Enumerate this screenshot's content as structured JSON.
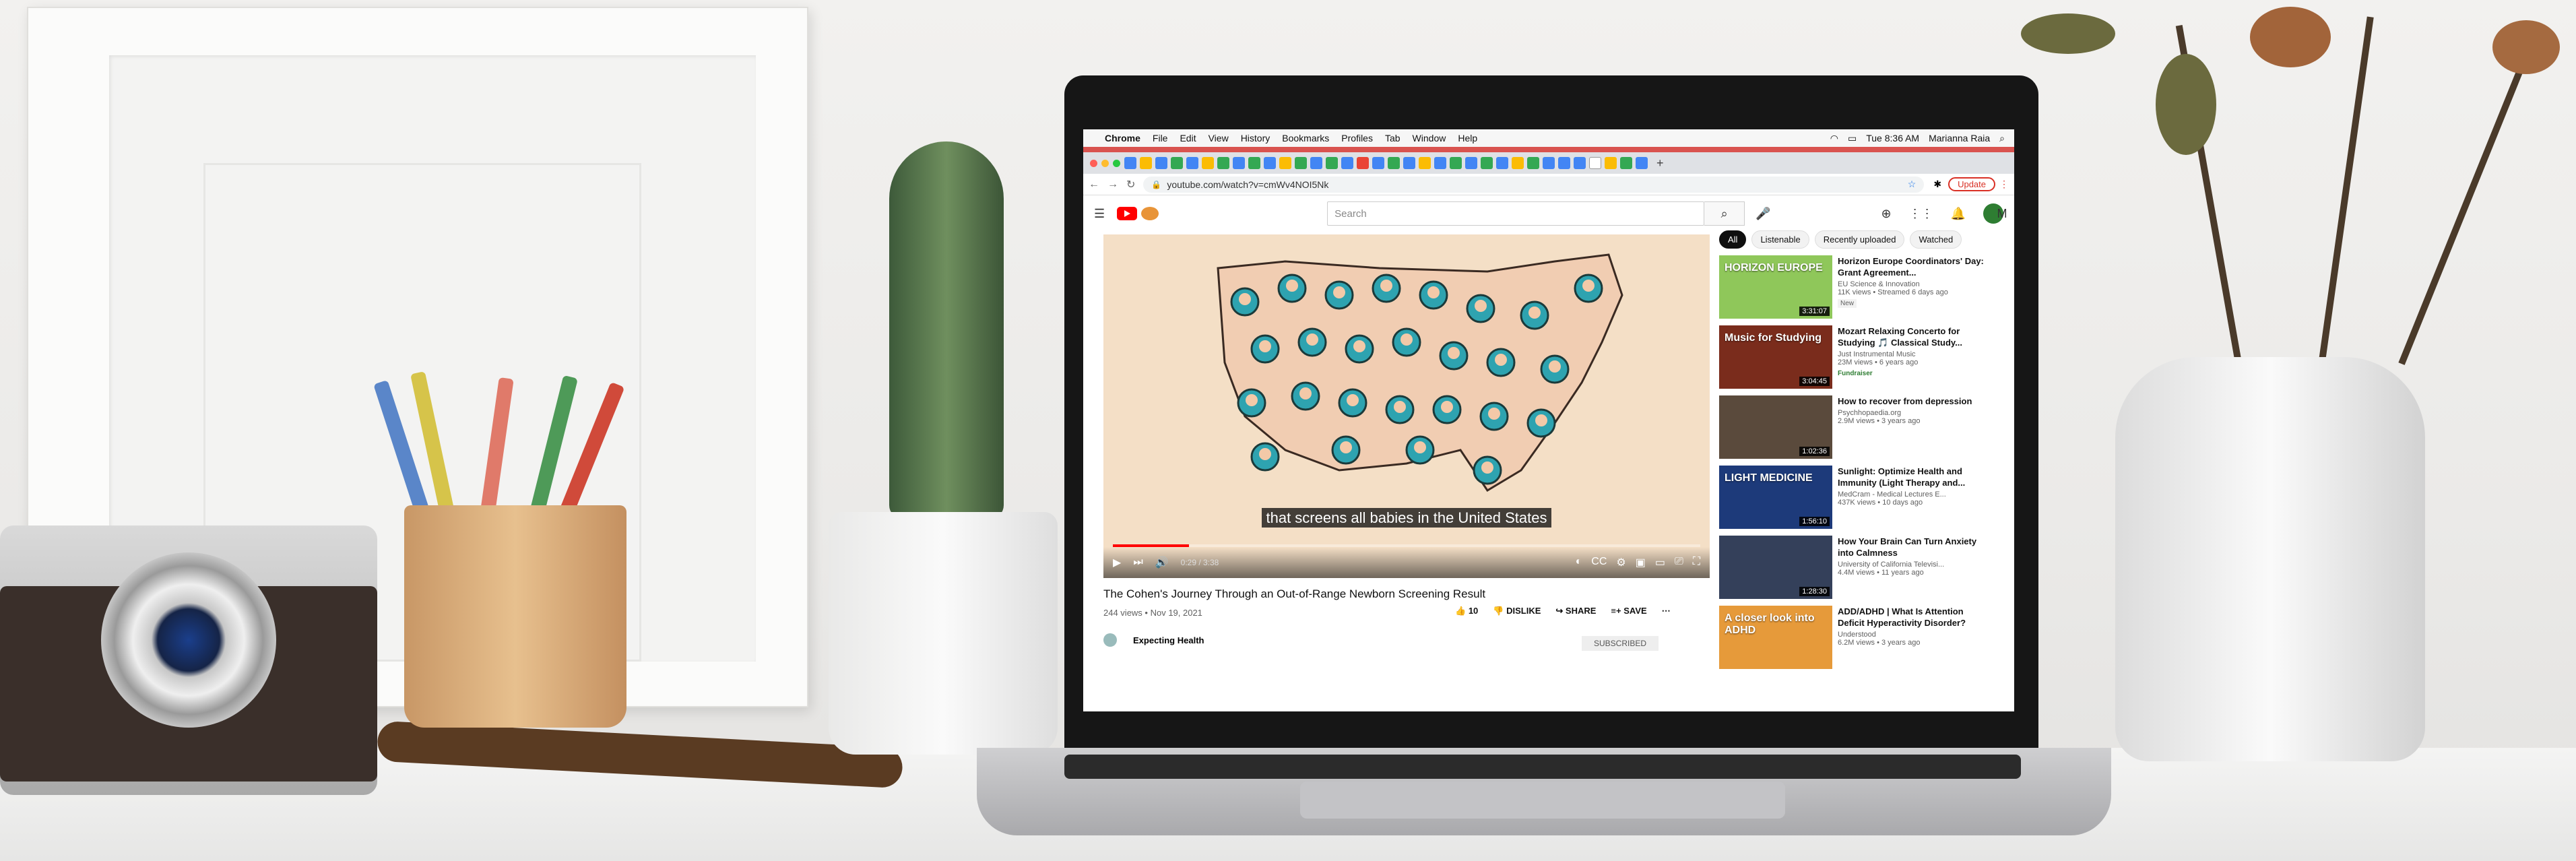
{
  "menubar": {
    "app": "Chrome",
    "items": [
      "File",
      "Edit",
      "View",
      "History",
      "Bookmarks",
      "Profiles",
      "Tab",
      "Window",
      "Help"
    ],
    "clock": "Tue 8:36 AM",
    "user": "Marianna Raia"
  },
  "browser": {
    "url": "youtube.com/watch?v=cmWv4NOI5Nk",
    "update_label": "Update"
  },
  "youtube": {
    "search_placeholder": "Search",
    "avatar_letter": "M",
    "video": {
      "caption": "that screens all babies in the United States",
      "time": "0:29 / 3:38",
      "progress": 0.13,
      "title": "The Cohen's Journey Through an Out-of-Range Newborn Screening Result",
      "meta": "244 views • Nov 19, 2021",
      "likes": "10",
      "dislike_label": "DISLIKE",
      "share_label": "SHARE",
      "save_label": "SAVE",
      "channel": "Expecting Health",
      "subscribed_label": "SUBSCRIBED"
    },
    "chips": [
      "All",
      "Listenable",
      "Recently uploaded",
      "Watched"
    ],
    "recommendations": [
      {
        "title": "Horizon Europe Coordinators' Day: Grant Agreement...",
        "channel": "EU Science & Innovation",
        "meta": "11K views • Streamed 6 days ago",
        "badge": "New",
        "duration": "3:31:07",
        "color": "#8fc75a"
      },
      {
        "title": "Mozart Relaxing Concerto for Studying 🎵 Classical Study...",
        "channel": "Just Instrumental Music",
        "meta": "23M views • 6 years ago",
        "badge": "Fundraiser",
        "duration": "3:04:45",
        "color": "#7a2c1c"
      },
      {
        "title": "How to recover from depression",
        "channel": "Psychhopaedia.org",
        "meta": "2.9M views • 3 years ago",
        "badge": "",
        "duration": "1:02:36",
        "color": "#5a4a3c"
      },
      {
        "title": "Sunlight: Optimize Health and Immunity (Light Therapy and...",
        "channel": "MedCram - Medical Lectures E...",
        "meta": "437K views • 10 days ago",
        "badge": "",
        "duration": "1:56:10",
        "color": "#1d3a7a"
      },
      {
        "title": "How Your Brain Can Turn Anxiety into Calmness",
        "channel": "University of California Televisi...",
        "meta": "4.4M views • 11 years ago",
        "badge": "",
        "duration": "1:28:30",
        "color": "#34405a"
      },
      {
        "title": "ADD/ADHD | What Is Attention Deficit Hyperactivity Disorder?",
        "channel": "Understood",
        "meta": "6.2M views • 3 years ago",
        "badge": "",
        "duration": "",
        "color": "#e69a3a"
      }
    ],
    "thumb_texts": [
      "HORIZON EUROPE",
      "Music for Studying",
      "",
      "LIGHT MEDICINE",
      "",
      "A closer look into ADHD"
    ]
  }
}
